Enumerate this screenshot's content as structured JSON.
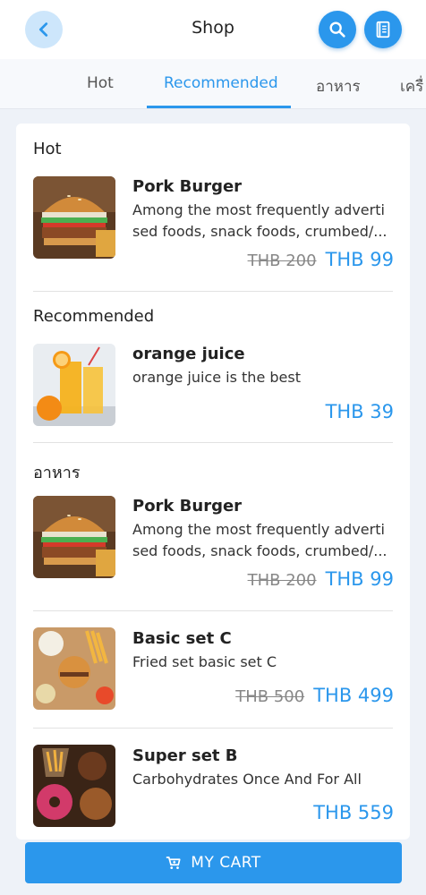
{
  "header": {
    "title": "Shop",
    "back_icon": "chevron-left-icon",
    "search_icon": "search-icon",
    "menu_icon": "book-icon"
  },
  "tabs": [
    {
      "label": "Hot",
      "active": false
    },
    {
      "label": "Recommended",
      "active": true
    },
    {
      "label": "อาหาร",
      "active": false
    },
    {
      "label": "เครื่",
      "active": false
    }
  ],
  "sections": [
    {
      "title": "Hot",
      "items": [
        {
          "name": "Pork Burger",
          "desc_line1": "Among the most frequently adverti",
          "desc_line2": "sed foods, snack foods, crumbed/...",
          "old_price": "THB 200",
          "price": "THB 99",
          "image": "burger"
        }
      ]
    },
    {
      "title": "Recommended",
      "items": [
        {
          "name": "orange juice",
          "desc_line1": "orange juice  is the best",
          "desc_line2": "",
          "old_price": "",
          "price": "THB 39",
          "image": "orange-juice"
        }
      ]
    },
    {
      "title": "อาหาร",
      "items": [
        {
          "name": "Pork Burger",
          "desc_line1": "Among the most frequently adverti",
          "desc_line2": "sed foods, snack foods, crumbed/...",
          "old_price": "THB 200",
          "price": "THB 99",
          "image": "burger"
        },
        {
          "name": "Basic set C",
          "desc_line1": "Fried set basic set C",
          "desc_line2": "",
          "old_price": "THB 500",
          "price": "THB 499",
          "image": "fried-set"
        },
        {
          "name": "Super set B",
          "desc_line1": "Carbohydrates Once And For All",
          "desc_line2": "",
          "old_price": "",
          "price": "THB 559",
          "image": "super-set"
        }
      ]
    }
  ],
  "cart": {
    "label": "MY CART",
    "icon": "cart-icon"
  },
  "colors": {
    "accent": "#2b97ec",
    "accent_light": "#cde6fb"
  }
}
